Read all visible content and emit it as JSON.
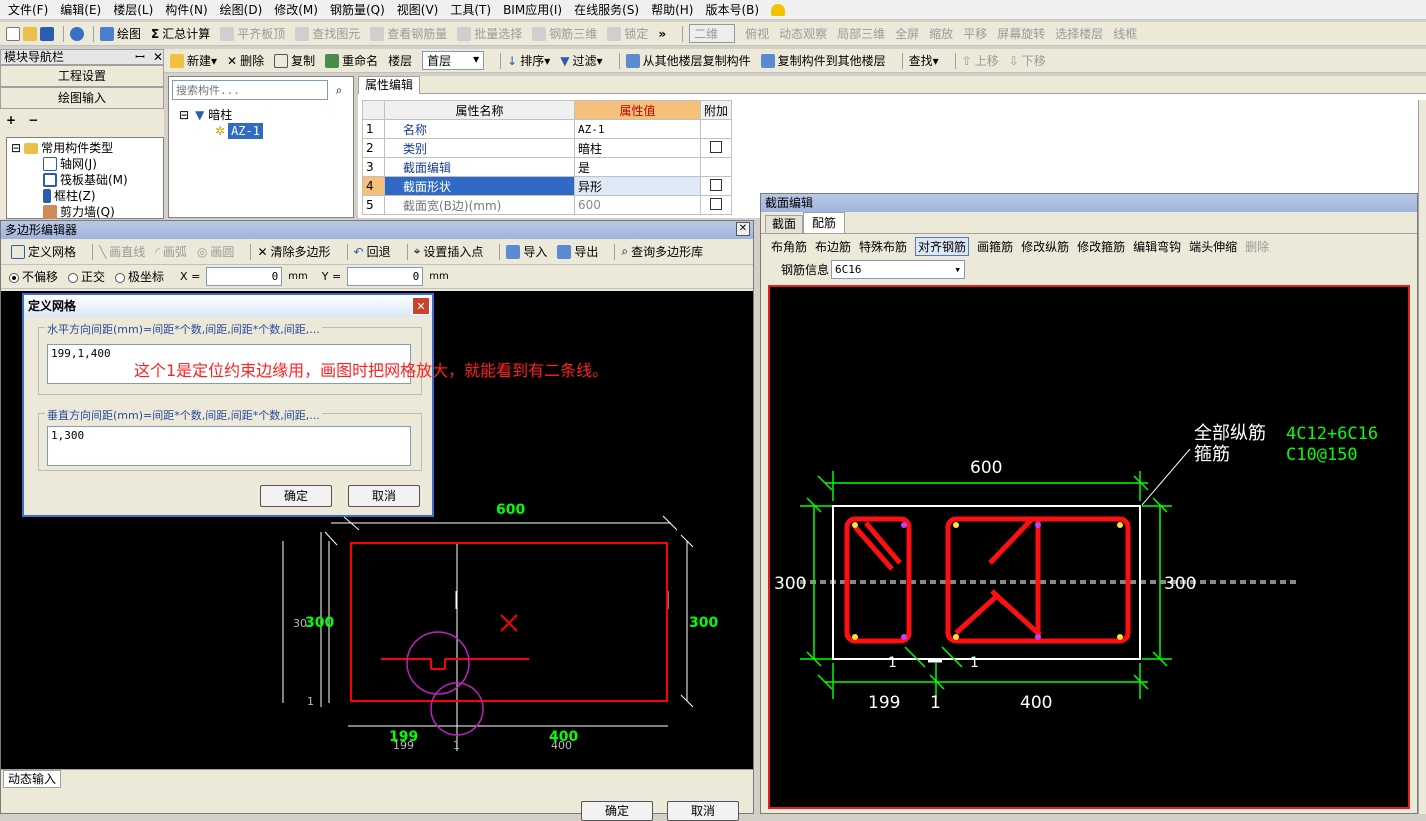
{
  "menu": [
    "文件(F)",
    "编辑(E)",
    "楼层(L)",
    "构件(N)",
    "绘图(D)",
    "修改(M)",
    "钢筋量(Q)",
    "视图(V)",
    "工具(T)",
    "BIM应用(I)",
    "在线服务(S)",
    "帮助(H)",
    "版本号(B)"
  ],
  "toolbar1": {
    "draw": "绘图",
    "sum": "汇总计算",
    "align": "平齐板顶",
    "find_elem": "查找图元",
    "view_rebar": "查看钢筋量",
    "batch": "批量选择",
    "rebar3d": "钢筋三维",
    "lock": "锁定",
    "view_mode": "二维",
    "top_view": "俯视",
    "dyn": "动态观察",
    "local3d": "局部三维",
    "full": "全屏",
    "zoom": "缩放",
    "pan": "平移",
    "rotate": "屏幕旋转",
    "select_floor": "选择楼层",
    "more": "线框"
  },
  "toolbar2": {
    "new": "新建",
    "delete": "删除",
    "copy": "复制",
    "rename": "重命名",
    "floor_label": "楼层",
    "floor_value": "首层",
    "sort": "排序",
    "filter": "过滤",
    "copy_from": "从其他楼层复制构件",
    "copy_to": "复制构件到其他楼层",
    "find": "查找",
    "up": "上移",
    "down": "下移"
  },
  "nav": {
    "title": "模块导航栏",
    "pin": "ꟷ",
    "close": "✕",
    "project": "工程设置",
    "draw_input": "绘图输入",
    "tree": [
      {
        "label": "常用构件类型",
        "level": 0
      },
      {
        "label": "轴网(J)",
        "level": 1
      },
      {
        "label": "筏板基础(M)",
        "level": 1
      },
      {
        "label": "框柱(Z)",
        "level": 1
      },
      {
        "label": "剪力墙(Q)",
        "level": 1
      }
    ]
  },
  "component_list": {
    "search_placeholder": "搜索构件...",
    "group": "暗柱",
    "item": "AZ-1"
  },
  "property": {
    "tab": "属性编辑",
    "headers": [
      "属性名称",
      "属性值",
      "附加"
    ],
    "rows": [
      {
        "no": "1",
        "name": "名称",
        "value": "AZ-1",
        "check": false
      },
      {
        "no": "2",
        "name": "类别",
        "value": "暗柱",
        "check": true
      },
      {
        "no": "3",
        "name": "截面编辑",
        "value": "是",
        "check": false
      },
      {
        "no": "4",
        "name": "截面形状",
        "value": "异形",
        "check": true
      },
      {
        "no": "5",
        "name": "截面宽(B边)(mm)",
        "value": "600",
        "check": true
      }
    ]
  },
  "poly_editor": {
    "title": "多边形编辑器",
    "tools": [
      "定义网格",
      "画直线",
      "画弧",
      "画圆",
      "清除多边形",
      "回退",
      "设置插入点",
      "导入",
      "导出",
      "查询多边形库"
    ],
    "modes": [
      "不偏移",
      "正交",
      "极坐标"
    ],
    "x_label": "X =",
    "x_val": "0",
    "y_label": "Y =",
    "y_val": "0",
    "unit": "mm",
    "status": "动态输入",
    "ok": "确定",
    "cancel": "取消",
    "dims": {
      "top": "600",
      "left_a": "30",
      "left_b": "300",
      "right": "300",
      "bot1": "199",
      "bot1b": "199",
      "bot2": "1",
      "bot3": "400",
      "bot3b": "400",
      "one": "1"
    }
  },
  "grid_dialog": {
    "title": "定义网格",
    "h_label": "水平方向间距(mm)=间距*个数,间距,间距*个数,间距,...",
    "h_value": "199,1,400",
    "v_label": "垂直方向间距(mm)=间距*个数,间距,间距*个数,间距,...",
    "v_value": "1,300",
    "ok": "确定",
    "cancel": "取消"
  },
  "annotation": "这个1是定位约束边缘用，画图时把网格放大，就能看到有二条线。",
  "section_editor": {
    "title": "截面编辑",
    "tabs": [
      "截面",
      "配筋"
    ],
    "tools": [
      "布角筋",
      "布边筋",
      "特殊布筋",
      "对齐钢筋",
      "画箍筋",
      "修改纵筋",
      "修改箍筋",
      "编辑弯钩",
      "端头伸缩",
      "删除"
    ],
    "rebar_label": "钢筋信息",
    "rebar_value": "6C16",
    "label_all": "全部纵筋",
    "label_stirrup": "箍筋",
    "val_all": "4C12+6C16",
    "val_stirrup": "C10@150",
    "dims": {
      "top": "600",
      "left": "300",
      "right": "300",
      "b1": "199",
      "b2": "1",
      "b3": "400",
      "o1": "1",
      "o2": "1"
    }
  },
  "colors": {
    "accent": "#316ac5",
    "red": "#ff0000",
    "green": "#00ff00",
    "annot": "#ff0000"
  }
}
